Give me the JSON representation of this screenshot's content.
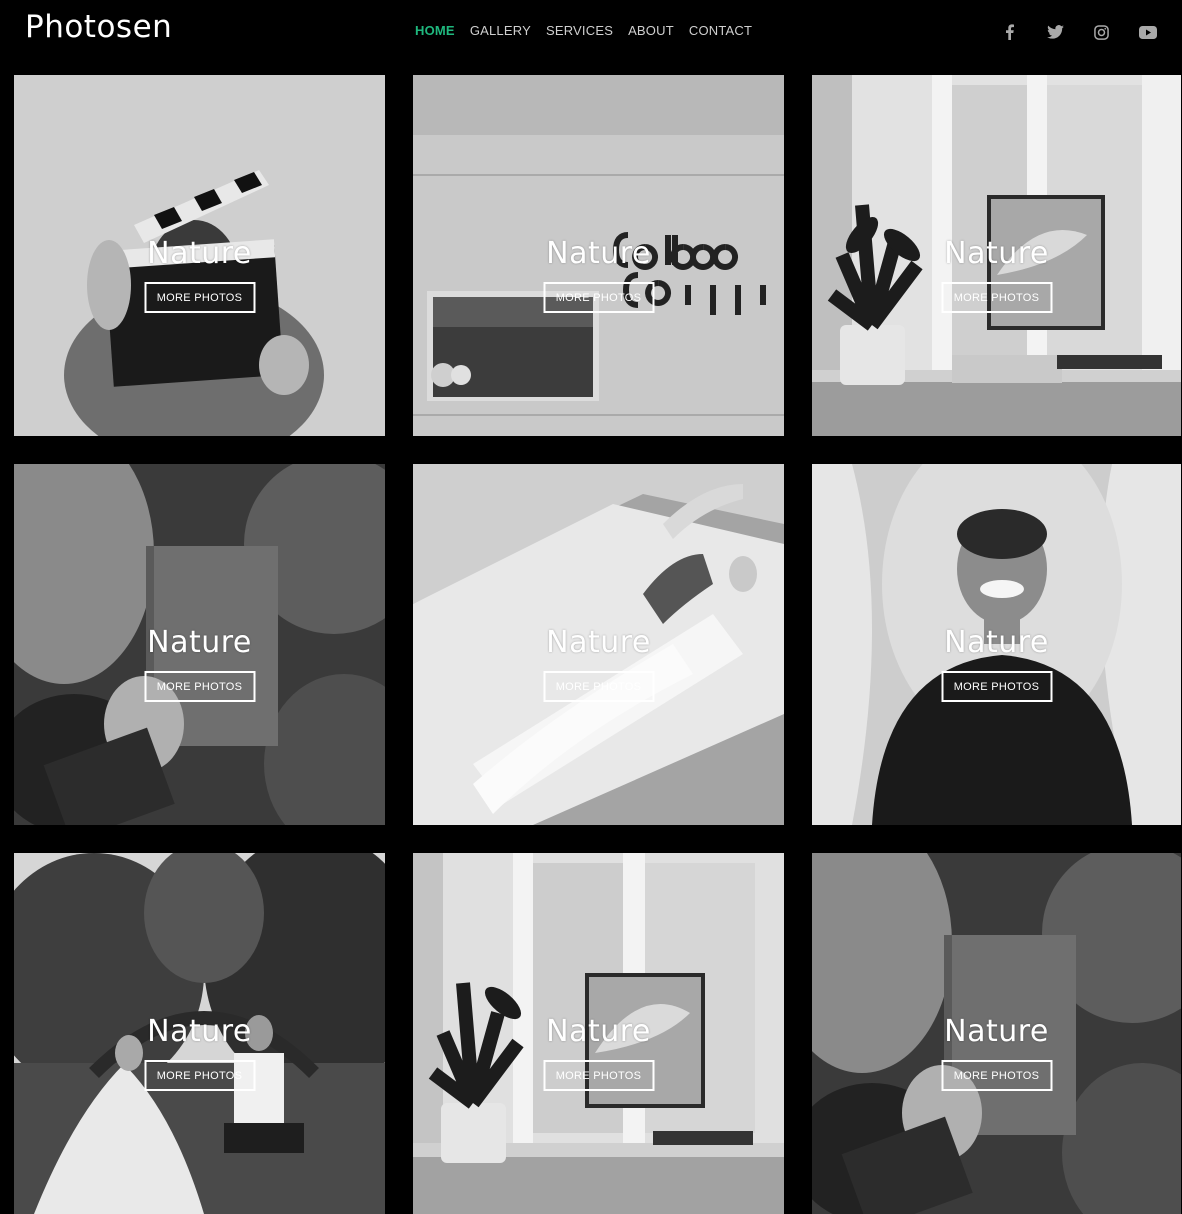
{
  "brand": {
    "name": "Photosen"
  },
  "nav": {
    "items": [
      {
        "label": "HOME",
        "active": true
      },
      {
        "label": "GALLERY",
        "active": false
      },
      {
        "label": "SERVICES",
        "active": false
      },
      {
        "label": "ABOUT",
        "active": false
      },
      {
        "label": "CONTACT",
        "active": false
      }
    ],
    "active_color": "#1fb87e"
  },
  "social": [
    {
      "icon": "facebook-icon"
    },
    {
      "icon": "twitter-icon"
    },
    {
      "icon": "instagram-icon"
    },
    {
      "icon": "youtube-icon"
    }
  ],
  "gallery": {
    "tiles": [
      {
        "title": "Nature",
        "button": "MORE PHOTOS",
        "scene": "clapperboard-portrait"
      },
      {
        "title": "Nature",
        "button": "MORE PHOTOS",
        "scene": "coffee-shop-wall"
      },
      {
        "title": "Nature",
        "button": "MORE PHOTOS",
        "scene": "desk-monitor-plant"
      },
      {
        "title": "Nature",
        "button": "MORE PHOTOS",
        "scene": "hand-holding-book"
      },
      {
        "title": "Nature",
        "button": "MORE PHOTOS",
        "scene": "woman-lying-on-bed"
      },
      {
        "title": "Nature",
        "button": "MORE PHOTOS",
        "scene": "smiling-man"
      },
      {
        "title": "Nature",
        "button": "MORE PHOTOS",
        "scene": "wedding-couple"
      },
      {
        "title": "Nature",
        "button": "MORE PHOTOS",
        "scene": "desk-monitor-plant"
      },
      {
        "title": "Nature",
        "button": "MORE PHOTOS",
        "scene": "hand-holding-book"
      }
    ]
  }
}
